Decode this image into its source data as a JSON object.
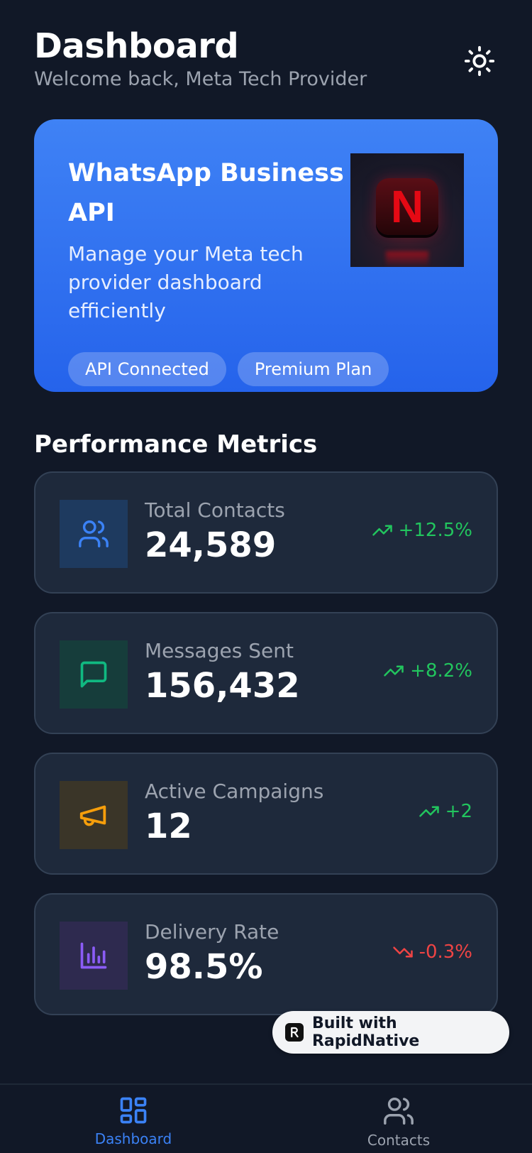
{
  "header": {
    "title": "Dashboard",
    "subtitle": "Welcome back, Meta Tech Provider",
    "theme_icon": "sun-icon"
  },
  "hero": {
    "title": "WhatsApp Business API",
    "description": "Manage your Meta tech provider dashboard efficiently",
    "badges": [
      "API Connected",
      "Premium Plan"
    ],
    "image_letter": "N"
  },
  "metrics_section": {
    "title": "Performance Metrics"
  },
  "metrics": [
    {
      "label": "Total Contacts",
      "value": "24,589",
      "trend": "+12.5%",
      "direction": "up",
      "icon": "users-icon",
      "icon_color": "#3b82f6",
      "icon_bg": "#1e3a5f"
    },
    {
      "label": "Messages Sent",
      "value": "156,432",
      "trend": "+8.2%",
      "direction": "up",
      "icon": "message-icon",
      "icon_color": "#10b981",
      "icon_bg": "#163d3b"
    },
    {
      "label": "Active Campaigns",
      "value": "12",
      "trend": "+2",
      "direction": "up",
      "icon": "megaphone-icon",
      "icon_color": "#f59e0b",
      "icon_bg": "#3a3528"
    },
    {
      "label": "Delivery Rate",
      "value": "98.5%",
      "trend": "-0.3%",
      "direction": "down",
      "icon": "bar-chart-icon",
      "icon_color": "#8b5cf6",
      "icon_bg": "#2e2a4f"
    }
  ],
  "built_with": {
    "label": "Built with RapidNative"
  },
  "bottom_nav": {
    "items": [
      {
        "label": "Dashboard",
        "icon": "grid-icon",
        "active": true
      },
      {
        "label": "Contacts",
        "icon": "users-icon",
        "active": false
      }
    ]
  },
  "colors": {
    "background": "#111827",
    "card": "#1e293b",
    "accent": "#3b82f6",
    "positive": "#22c55e",
    "negative": "#ef4444"
  }
}
